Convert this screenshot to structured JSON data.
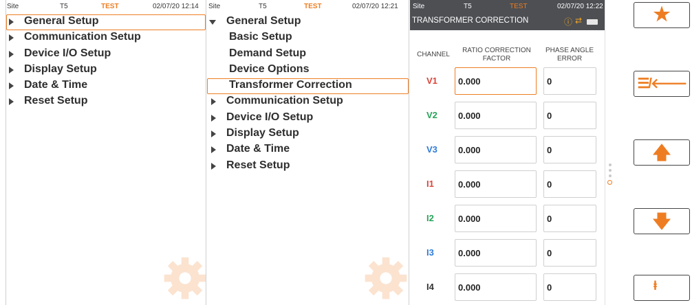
{
  "panel1": {
    "status": {
      "site": "Site",
      "device": "T5",
      "mode": "TEST",
      "time": "02/07/20 12:14"
    },
    "menu": [
      "General Setup",
      "Communication Setup",
      "Device I/O Setup",
      "Display Setup",
      "Date & Time",
      "Reset Setup"
    ]
  },
  "panel2": {
    "status": {
      "site": "Site",
      "device": "T5",
      "mode": "TEST",
      "time": "02/07/20 12:21"
    },
    "menu": {
      "general": "General Setup",
      "sub": [
        "Basic Setup",
        "Demand Setup",
        "Device Options",
        "Transformer Correction"
      ],
      "rest": [
        "Communication Setup",
        "Device I/O Setup",
        "Display Setup",
        "Date & Time",
        "Reset Setup"
      ]
    }
  },
  "panel3": {
    "status": {
      "site": "Site",
      "device": "T5",
      "mode": "TEST",
      "time": "02/07/20 12:22"
    },
    "title": "TRANSFORMER CORRECTION",
    "columns": {
      "channel": "CHANNEL",
      "ratio_1": "RATIO CORRECTION",
      "ratio_2": "FACTOR",
      "phase_1": "PHASE ANGLE",
      "phase_2": "ERROR"
    },
    "rows": [
      {
        "channel": "V1",
        "ratio": "0.000",
        "phase": "0",
        "color": "#d9453b"
      },
      {
        "channel": "V2",
        "ratio": "0.000",
        "phase": "0",
        "color": "#27a35a"
      },
      {
        "channel": "V3",
        "ratio": "0.000",
        "phase": "0",
        "color": "#2f7bd6"
      },
      {
        "channel": "I1",
        "ratio": "0.000",
        "phase": "0",
        "color": "#d9453b"
      },
      {
        "channel": "I2",
        "ratio": "0.000",
        "phase": "0",
        "color": "#27a35a"
      },
      {
        "channel": "I3",
        "ratio": "0.000",
        "phase": "0",
        "color": "#2f7bd6"
      },
      {
        "channel": "I4",
        "ratio": "0.000",
        "phase": "0",
        "color": "#333333"
      }
    ]
  },
  "side_buttons": [
    {
      "icon": "star-icon",
      "glyph": "★"
    },
    {
      "icon": "menu-back-icon",
      "glyph": "☰/🡐"
    },
    {
      "icon": "arrow-up-icon",
      "glyph": "🡅"
    },
    {
      "icon": "arrow-down-icon",
      "glyph": "🡇"
    },
    {
      "icon": "wave-icon",
      "glyph": "ⱡ"
    }
  ],
  "colors": {
    "accent": "#ee7d22",
    "header": "#4d4f53"
  }
}
